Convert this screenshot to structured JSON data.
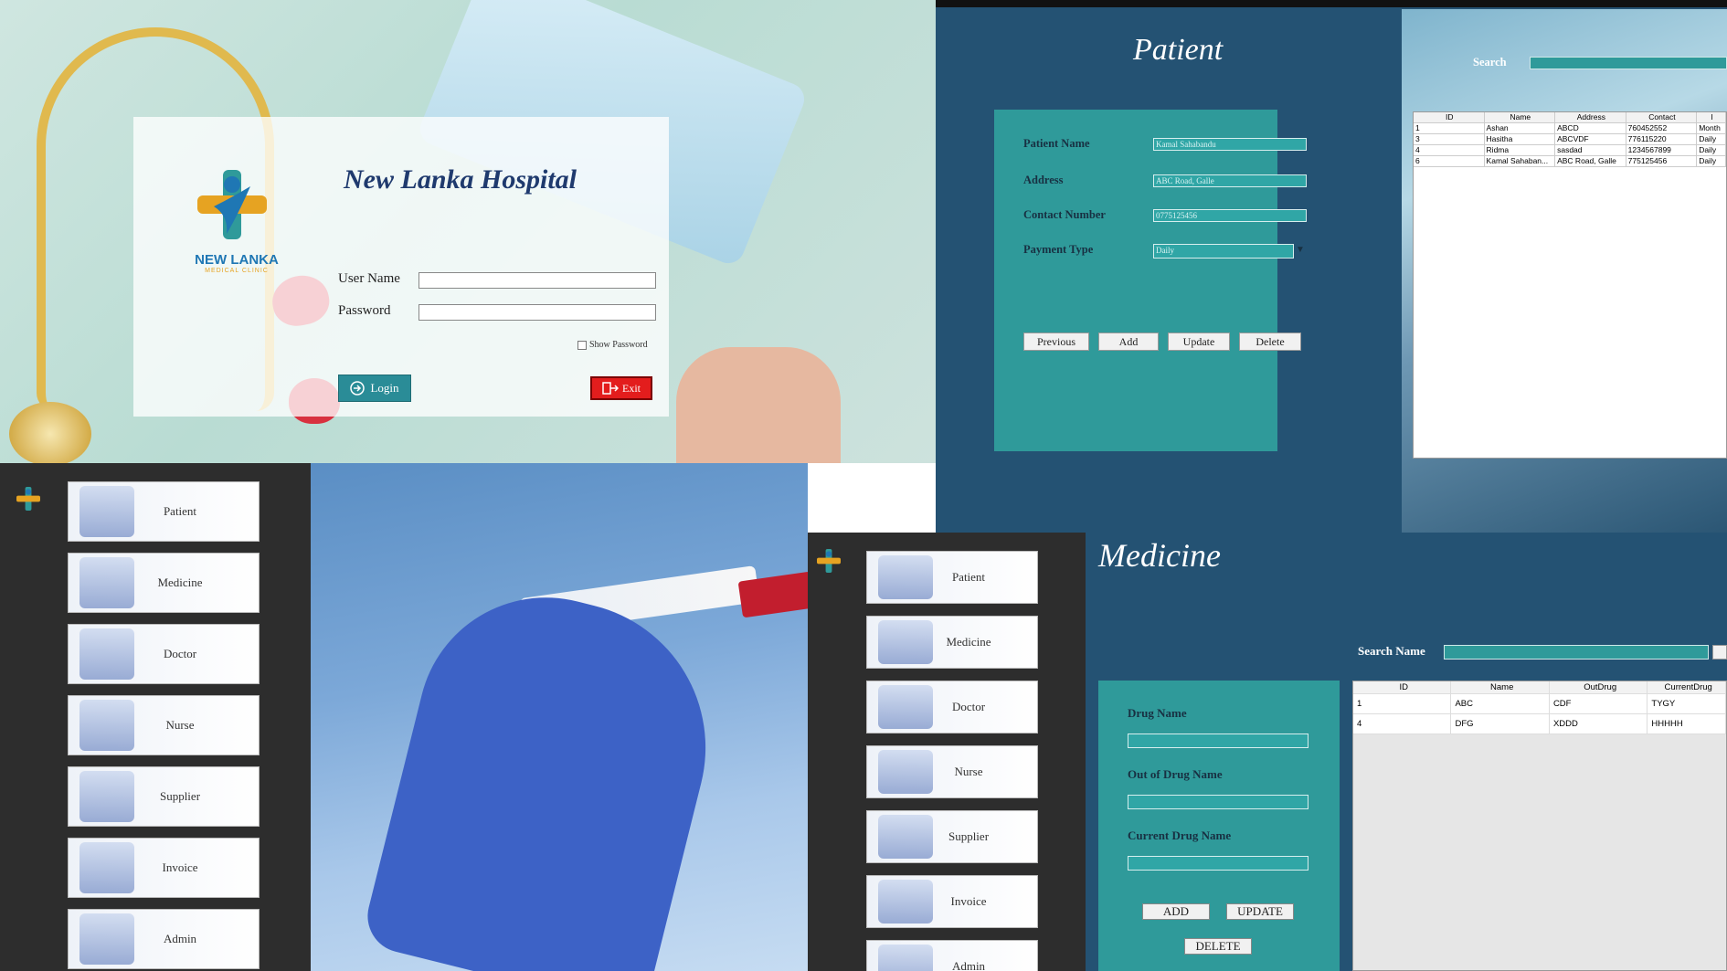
{
  "login": {
    "title": "New Lanka Hospital",
    "brand_name": "NEW LANKA",
    "brand_sub": "MEDICAL CLINIC",
    "username_label": "User Name",
    "username_value": "",
    "password_label": "Password",
    "password_value": "",
    "show_password_label": "Show Password",
    "login_label": "Login",
    "exit_label": "Exit"
  },
  "patient": {
    "title": "Patient",
    "fields": {
      "name_label": "Patient Name",
      "name_value": "Kamal Sahabandu",
      "address_label": "Address",
      "address_value": "ABC Road, Galle",
      "contact_label": "Contact Number",
      "contact_value": "0775125456",
      "payment_label": "Payment Type",
      "payment_value": "Daily"
    },
    "buttons": {
      "previous": "Previous",
      "add": "Add",
      "update": "Update",
      "delete": "Delete"
    },
    "search_label": "Search",
    "table": {
      "headers": [
        "ID",
        "Name",
        "Address",
        "Contact",
        "I"
      ],
      "rows": [
        [
          "1",
          "Ashan",
          "ABCD",
          "760452552",
          "Month"
        ],
        [
          "3",
          "Hasitha",
          "ABCVDF",
          "776115220",
          "Daily"
        ],
        [
          "4",
          "Ridma",
          "sasdad",
          "1234567899",
          "Daily"
        ],
        [
          "6",
          "Kamal Sahaban...",
          "ABC Road, Galle",
          "775125456",
          "Daily"
        ]
      ]
    }
  },
  "dashboard": {
    "nav": [
      {
        "label": "Patient"
      },
      {
        "label": "Medicine"
      },
      {
        "label": "Doctor"
      },
      {
        "label": "Nurse"
      },
      {
        "label": "Supplier"
      },
      {
        "label": "Invoice"
      },
      {
        "label": "Admin"
      }
    ]
  },
  "medicine": {
    "title": "Medicine",
    "search_label": "Search Name",
    "fields": {
      "drug_label": "Drug Name",
      "out_label": "Out of Drug Name",
      "current_label": "Current Drug Name"
    },
    "buttons": {
      "add": "ADD",
      "update": "UPDATE",
      "delete": "DELETE"
    },
    "table": {
      "headers": [
        "ID",
        "Name",
        "OutDrug",
        "CurrentDrug"
      ],
      "rows": [
        [
          "1",
          "ABC",
          "CDF",
          "TYGY"
        ],
        [
          "4",
          "DFG",
          "XDDD",
          "HHHHH"
        ]
      ]
    },
    "nav": [
      {
        "label": "Patient"
      },
      {
        "label": "Medicine"
      },
      {
        "label": "Doctor"
      },
      {
        "label": "Nurse"
      },
      {
        "label": "Supplier"
      },
      {
        "label": "Invoice"
      },
      {
        "label": "Admin"
      }
    ]
  },
  "colors": {
    "navy": "#245273",
    "teal": "#2f9a9a",
    "dark": "#2d2d2d",
    "exit_red": "#e31d1d"
  }
}
